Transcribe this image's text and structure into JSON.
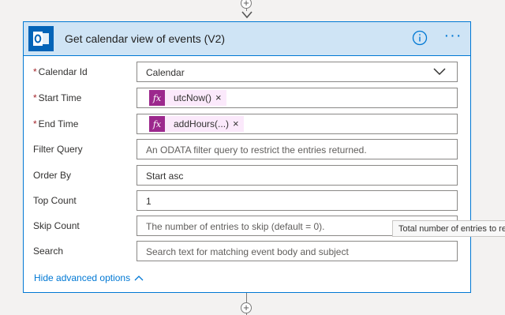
{
  "card": {
    "title": "Get calendar view of events (V2)",
    "icon": "outlook-icon",
    "accent_color": "#0078d4",
    "header_bg": "#cfe4f5"
  },
  "fields": {
    "calendar_id": {
      "label": "Calendar Id",
      "required": "*",
      "value": "Calendar"
    },
    "start_time": {
      "label": "Start Time",
      "required": "*",
      "token": "utcNow()",
      "token_icon": "fx"
    },
    "end_time": {
      "label": "End Time",
      "required": "*",
      "token": "addHours(...)",
      "token_icon": "fx"
    },
    "filter_query": {
      "label": "Filter Query",
      "placeholder": "An ODATA filter query to restrict the entries returned."
    },
    "order_by": {
      "label": "Order By",
      "value": "Start asc"
    },
    "top_count": {
      "label": "Top Count",
      "value": "1"
    },
    "skip_count": {
      "label": "Skip Count",
      "placeholder": "The number of entries to skip (default = 0)."
    },
    "search": {
      "label": "Search",
      "placeholder": "Search text for matching event body and subject"
    }
  },
  "hide_advanced": "Hide advanced options",
  "tooltip": "Total number of entries to re",
  "close_glyph": "×"
}
